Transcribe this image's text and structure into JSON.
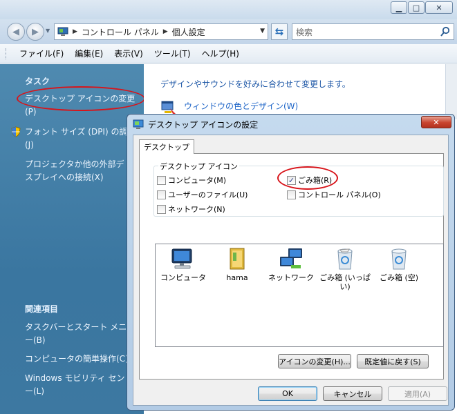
{
  "window": {
    "address": {
      "crumbs": [
        "コントロール パネル",
        "個人設定"
      ]
    },
    "search_placeholder": "検索",
    "caption_buttons": {
      "minimize": "▁",
      "maximize": "□",
      "close": "✕"
    }
  },
  "menubar": {
    "items": [
      "ファイル(F)",
      "編集(E)",
      "表示(V)",
      "ツール(T)",
      "ヘルプ(H)"
    ]
  },
  "sidebar": {
    "tasks_heading": "タスク",
    "tasks": [
      {
        "label": "デスクトップ アイコンの変更",
        "sub": "(P)"
      },
      {
        "label": "フォント サイズ (DPI) の調",
        "sub": "(J)"
      },
      {
        "label": "プロジェクタか他の外部デ",
        "sub": "スプレイへの接続(X)"
      }
    ],
    "related_heading": "関連項目",
    "related": [
      {
        "label": "タスクバーとスタート メニュ",
        "sub": "ー(B)"
      },
      {
        "label": "コンピュータの簡単操作(C)"
      },
      {
        "label": "Windows モビリティ セン",
        "sub": "ー(L)"
      }
    ]
  },
  "content": {
    "description": "デザインやサウンドを好みに合わせて変更します。",
    "window_color_link": "ウィンドウの色とデザイン(W)"
  },
  "dialog": {
    "title": "デスクトップ アイコンの設定",
    "close_label": "✕",
    "tab": "デスクトップ",
    "group_label": "デスクトップ アイコン",
    "checkboxes": [
      {
        "label": "コンピュータ(M)",
        "checked": false
      },
      {
        "label": "ごみ箱(R)",
        "checked": true
      },
      {
        "label": "ユーザーのファイル(U)",
        "checked": false
      },
      {
        "label": "コントロール パネル(O)",
        "checked": false
      },
      {
        "label": "ネットワーク(N)",
        "checked": false
      }
    ],
    "icons": [
      {
        "label": "コンピュータ",
        "icon": "computer-icon"
      },
      {
        "label": "hama",
        "icon": "user-folder-icon"
      },
      {
        "label": "ネットワーク",
        "icon": "network-icon"
      },
      {
        "label": "ごみ箱 (いっぱい)",
        "icon": "recycle-bin-full-icon"
      },
      {
        "label": "ごみ箱 (空)",
        "icon": "recycle-bin-empty-icon"
      }
    ],
    "change_icon_button": "アイコンの変更(H)...",
    "restore_default_button": "既定値に戻す(S)",
    "ok_button": "OK",
    "cancel_button": "キャンセル",
    "apply_button": "適用(A)"
  },
  "colors": {
    "sidebar_bg": "#3a76a0",
    "link_blue": "#1d64c7",
    "annotation_red": "#d8141a"
  }
}
